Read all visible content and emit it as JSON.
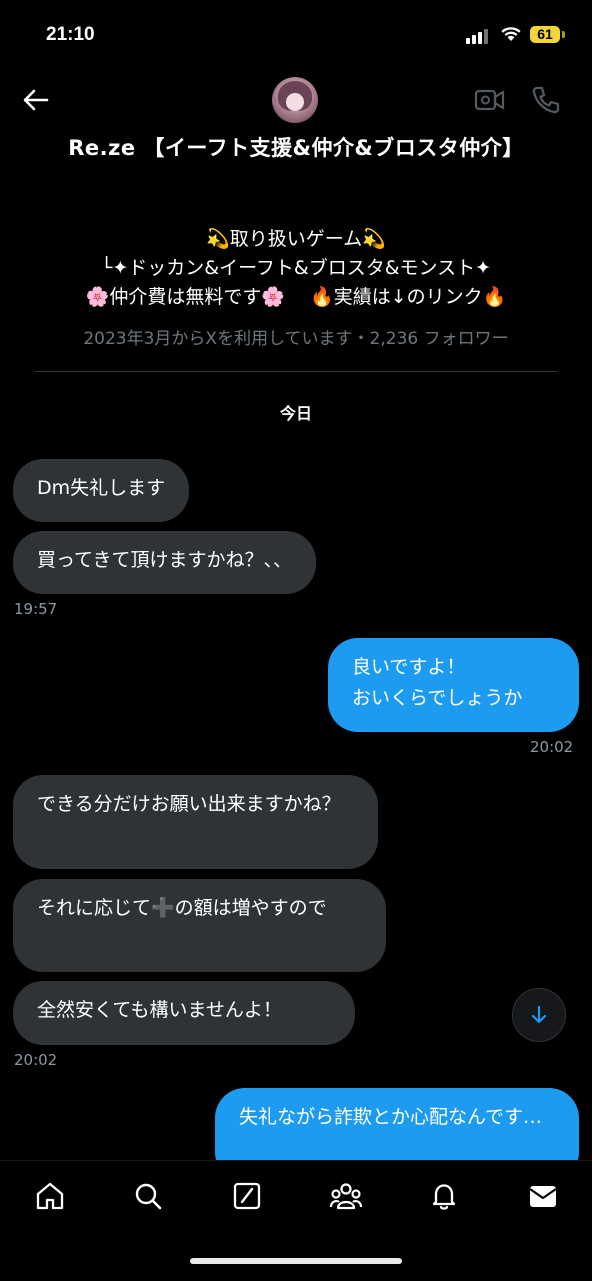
{
  "status_bar": {
    "time": "21:10",
    "battery": "61"
  },
  "header": {
    "title": "Re.ze 【イーフト支援&仲介&ブロスタ仲介】"
  },
  "profile": {
    "bio_line1": "💫取り扱いゲーム💫",
    "bio_line2": "└✦ドッカン&イーフト&ブロスタ&モンスト✦",
    "bio_line3": "🌸仲介費は無料です🌸　 🔥実績は↓のリンク🔥",
    "joined": "2023年3月からXを利用しています・2,236 フォロワー"
  },
  "day_label": "今日",
  "messages": [
    {
      "text": "Dm失礼します"
    },
    {
      "text": "買ってきて頂けますかね？、、"
    },
    {
      "text": "19:57"
    },
    {
      "text": "良いですよ！\nおいくらでしょうか"
    },
    {
      "text": "20:02"
    },
    {
      "text": "できる分だけお願い出来ますかね？"
    },
    {
      "text": "それに応じて➕の額は増やすので"
    },
    {
      "text": "全然安くても構いませんよ！"
    },
    {
      "text": "20:02"
    },
    {
      "text": "失礼ながら詐欺とか心配なんです…"
    }
  ],
  "icons": {
    "back": "arrow-left-icon",
    "video": "video-camera-icon",
    "call": "phone-icon",
    "scroll": "arrow-down-icon",
    "nav": [
      "home-icon",
      "search-icon",
      "grok-icon",
      "communities-icon",
      "notifications-icon",
      "messages-icon"
    ]
  },
  "colors": {
    "accent": "#1d9bf0",
    "incoming_bubble": "#2f3336",
    "background": "#000000"
  }
}
